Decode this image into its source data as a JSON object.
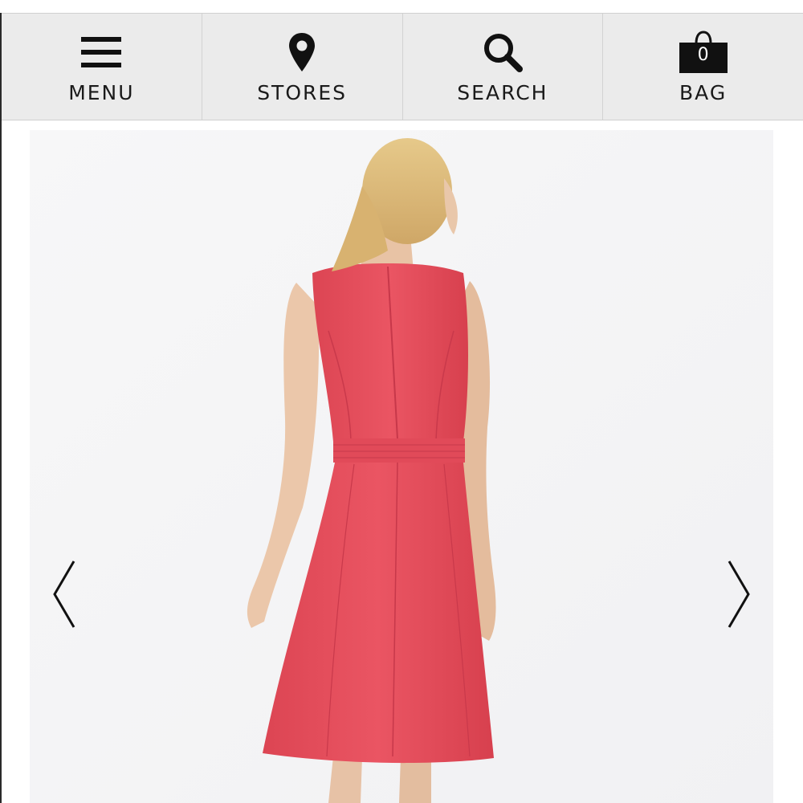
{
  "nav": {
    "menu_label": "MENU",
    "stores_label": "STORES",
    "search_label": "SEARCH",
    "bag_label": "BAG",
    "bag_count": "0"
  },
  "gallery": {
    "product_color": "#e8505e",
    "prev_icon": "chevron-left-icon",
    "next_icon": "chevron-right-icon"
  },
  "colors": {
    "navbar_bg": "#ebebeb",
    "icon": "#111111",
    "text": "#1a1a1a"
  }
}
